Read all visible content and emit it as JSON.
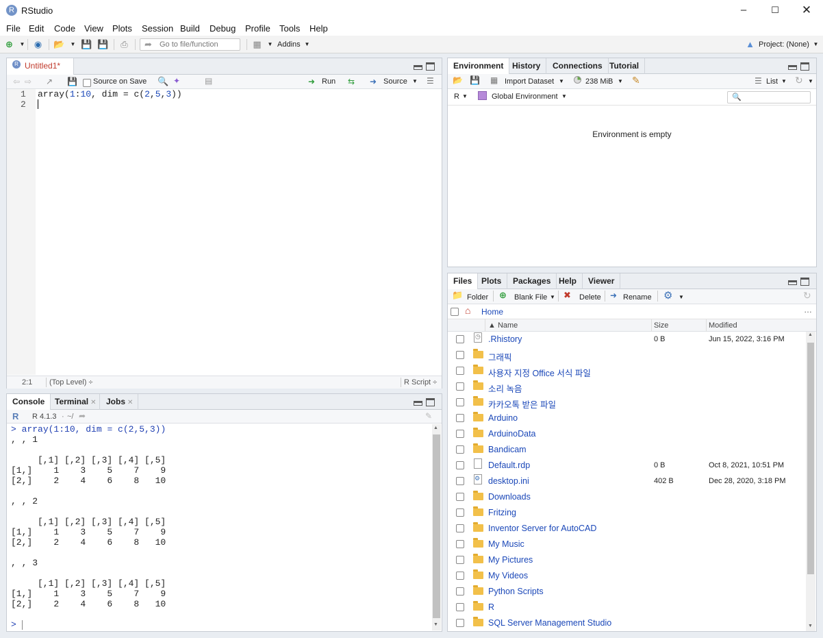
{
  "window": {
    "title": "RStudio",
    "r_logo": "R"
  },
  "menu": [
    "File",
    "Edit",
    "Code",
    "View",
    "Plots",
    "Session",
    "Build",
    "Debug",
    "Profile",
    "Tools",
    "Help"
  ],
  "toolbar": {
    "goto_placeholder": "Go to file/function",
    "addins": "Addins",
    "project": "Project: (None)"
  },
  "editor": {
    "tab": "Untitled1*",
    "source_on_save": "Source on Save",
    "run": "Run",
    "source": "Source",
    "lines": [
      "array(1:10, dim = c(2,5,3))",
      ""
    ],
    "line_numbers": [
      "1",
      "2"
    ],
    "status_pos": "2:1",
    "status_scope": "(Top Level) ÷",
    "status_type": "R Script ÷"
  },
  "console": {
    "tabs": [
      "Console",
      "Terminal",
      "Jobs"
    ],
    "r_version": "R 4.1.3",
    "path": "~/",
    "command": "array(1:10, dim = c(2,5,3))",
    "prompt": ">",
    "output": [
      ", , 1",
      "",
      "     [,1] [,2] [,3] [,4] [,5]",
      "[1,]    1    3    5    7    9",
      "[2,]    2    4    6    8   10",
      "",
      ", , 2",
      "",
      "     [,1] [,2] [,3] [,4] [,5]",
      "[1,]    1    3    5    7    9",
      "[2,]    2    4    6    8   10",
      "",
      ", , 3",
      "",
      "     [,1] [,2] [,3] [,4] [,5]",
      "[1,]    1    3    5    7    9",
      "[2,]    2    4    6    8   10"
    ]
  },
  "environment": {
    "tabs": [
      "Environment",
      "History",
      "Connections",
      "Tutorial"
    ],
    "import_dataset": "Import Dataset",
    "memory": "238 MiB",
    "view_mode": "List",
    "language": "R",
    "scope": "Global Environment",
    "empty_message": "Environment is empty"
  },
  "files": {
    "tabs": [
      "Files",
      "Plots",
      "Packages",
      "Help",
      "Viewer"
    ],
    "folder_btn": "Folder",
    "blank_file_btn": "Blank File",
    "delete_btn": "Delete",
    "rename_btn": "Rename",
    "breadcrumb": "Home",
    "columns": {
      "name": "▲ Name",
      "size": "Size",
      "modified": "Modified"
    },
    "rows": [
      {
        "name": ".Rhistory",
        "size": "0 B",
        "modified": "Jun 15, 2022, 3:16 PM",
        "kind": "history"
      },
      {
        "name": "그래픽",
        "size": "",
        "modified": "",
        "kind": "folder"
      },
      {
        "name": "사용자 지정 Office 서식 파일",
        "size": "",
        "modified": "",
        "kind": "folder"
      },
      {
        "name": "소리 녹음",
        "size": "",
        "modified": "",
        "kind": "folder"
      },
      {
        "name": "카카오톡 받은 파일",
        "size": "",
        "modified": "",
        "kind": "folder"
      },
      {
        "name": "Arduino",
        "size": "",
        "modified": "",
        "kind": "folder"
      },
      {
        "name": "ArduinoData",
        "size": "",
        "modified": "",
        "kind": "folder"
      },
      {
        "name": "Bandicam",
        "size": "",
        "modified": "",
        "kind": "folder"
      },
      {
        "name": "Default.rdp",
        "size": "0 B",
        "modified": "Oct 8, 2021, 10:51 PM",
        "kind": "file"
      },
      {
        "name": "desktop.ini",
        "size": "402 B",
        "modified": "Dec 28, 2020, 3:18 PM",
        "kind": "config"
      },
      {
        "name": "Downloads",
        "size": "",
        "modified": "",
        "kind": "folder"
      },
      {
        "name": "Fritzing",
        "size": "",
        "modified": "",
        "kind": "folder"
      },
      {
        "name": "Inventor Server for AutoCAD",
        "size": "",
        "modified": "",
        "kind": "folder"
      },
      {
        "name": "My Music",
        "size": "",
        "modified": "",
        "kind": "folder"
      },
      {
        "name": "My Pictures",
        "size": "",
        "modified": "",
        "kind": "folder"
      },
      {
        "name": "My Videos",
        "size": "",
        "modified": "",
        "kind": "folder"
      },
      {
        "name": "Python Scripts",
        "size": "",
        "modified": "",
        "kind": "folder"
      },
      {
        "name": "R",
        "size": "",
        "modified": "",
        "kind": "folder"
      },
      {
        "name": "SQL Server Management Studio",
        "size": "",
        "modified": "",
        "kind": "folder"
      }
    ]
  },
  "colors": {
    "accent": "#1a47b8",
    "folder": "#f2c04a",
    "tab_modified": "#c0392b",
    "console_cmd": "#1f3fb2"
  }
}
